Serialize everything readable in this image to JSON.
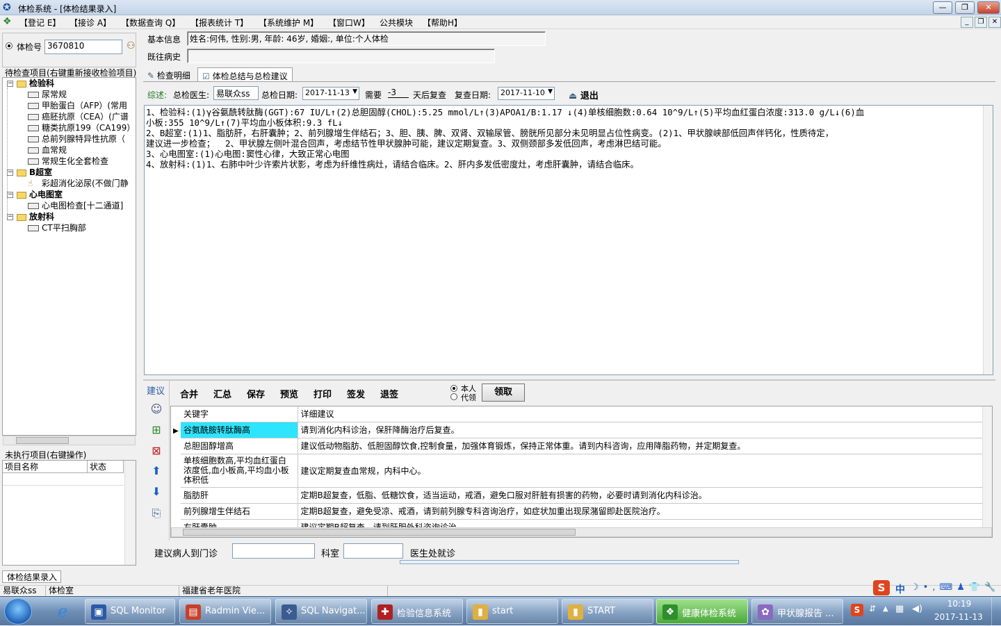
{
  "window": {
    "title": "体检系统 - [体检结果录入]"
  },
  "menu": [
    "【登记 E】",
    "【接诊 A】",
    "【数据查询 Q】",
    "【报表统计 T】",
    "【系统维护 M】",
    "【窗口W】",
    "公共模块",
    "【帮助H】"
  ],
  "left": {
    "exam_no_label": "体检号",
    "exam_no_value": "3670810",
    "pending_header": "待检查项目(右键重新接收检验项目)",
    "tree": [
      {
        "cat": "检验科",
        "items": [
          "尿常规",
          "甲胎蛋白（AFP）(常用",
          "癌胚抗原（CEA）(广谱",
          "糖类抗原199（CA199）",
          "总前列腺特异性抗原（",
          "血常规",
          "常规生化全套检查"
        ]
      },
      {
        "cat": "B超室",
        "items": [
          "彩超消化泌尿(不做门静"
        ]
      },
      {
        "cat": "心电图室",
        "items": [
          "心电图检查[十二通道]"
        ]
      },
      {
        "cat": "放射科",
        "items": [
          "CT平扫胸部"
        ]
      }
    ],
    "unexec_header": "未执行项目(右键操作)",
    "unexec_cols": [
      "项目名称",
      "状态"
    ],
    "tab_label": "体检结果录入"
  },
  "info": {
    "basic_label": "基本信息",
    "basic_value": "姓名:何伟, 性别:男, 年龄: 46岁, 婚姻:, 单位:个人体检",
    "history_label": "既往病史",
    "history_value": ""
  },
  "tabs": [
    "检查明细",
    "体检总结与总检建议"
  ],
  "summary_bar": {
    "label": "综述:",
    "doctor_label": "总检医生:",
    "doctor_value": "易联众ss",
    "date_label": "总检日期:",
    "date_value": "2017-11-13",
    "need_label": "需要",
    "need_value": "-3",
    "after_label": "天后复查",
    "review_label": "复查日期:",
    "review_value": "2017-11-10",
    "exit_label": "退出"
  },
  "summary_lines": [
    "1、检验科:(1)γ谷氨酰转肽酶(GGT):67 IU/L↑(2)总胆固醇(CHOL):5.25 mmol/L↑(3)APOA1/B:1.17 ↓(4)单核细胞数:0.64 10^9/L↑(5)平均血红蛋白浓度:313.0 g/L↓(6)血",
    "小板:355 10^9/L↑(7)平均血小板体积:9.3 fL↓",
    "2、B超室:(1)1、脂肪肝，右肝囊肿；2、前列腺增生伴结石；3、胆、胰、脾、双肾、双输尿管、膀胱所见部分未见明显占位性病变。(2)1、甲状腺峡部低回声伴钙化，性质待定，",
    "建议进一步检查；  2、甲状腺左侧叶混合回声，考虑结节性甲状腺肿可能，建议定期复查。3、双侧颈部多发低回声，考虑淋巴结可能。",
    "3、心电图室:(1)心电图:窦性心律，大致正常心电图",
    "4、放射科:(1)1、右肺中叶少许索片状影，考虑为纤维性病灶，请结合临床。2、肝内多发低密度灶，考虑肝囊肿，请结合临床。"
  ],
  "advice": {
    "side_label": "建议",
    "toolbar": [
      "合并",
      "汇总",
      "保存",
      "预览",
      "打印",
      "签发",
      "退签"
    ],
    "radio_self": "本人",
    "radio_proxy": "代领",
    "receive": "领取",
    "cols": [
      "关键字",
      "详细建议"
    ],
    "rows": [
      {
        "k": "谷氨酰胺转肽酶高",
        "v": "请到消化内科诊治，保肝降酶治疗后复查。"
      },
      {
        "k": "总胆固醇增高",
        "v": "建议低动物脂肪、低胆固醇饮食,控制食量，加强体育锻炼，保持正常体重。请到内科咨询，应用降脂药物，并定期复查。"
      },
      {
        "k": "单核细胞数高,平均血红蛋白浓度低,血小板高,平均血小板体积低",
        "v": "建议定期复查血常规，内科中心。"
      },
      {
        "k": "脂肪肝",
        "v": "定期B超复查，低脂、低糖饮食，适当运动，戒酒，避免口服对肝脏有损害的药物，必要时请到消化内科诊治。"
      },
      {
        "k": "前列腺增生伴结石",
        "v": "定期B超复查，避免受凉、戒酒，请到前列腺专科咨询治疗，如症状加重出现尿潴留即赴医院治疗。"
      },
      {
        "k": "右肝囊肿",
        "v": "建议定期B超复查，请到肝胆外科咨询诊治。"
      }
    ],
    "refer_label": "建议病人到门诊",
    "dept_label": "科室",
    "refer_tail": "医生处就诊"
  },
  "status": [
    "易联众ss",
    "体检室",
    "福建省老年医院"
  ],
  "taskbar": [
    {
      "label": "SQL Monitor",
      "color": "#2a5aa8"
    },
    {
      "label": "Radmin Vie...",
      "color": "#c8402a"
    },
    {
      "label": "SQL Navigat...",
      "color": "#3a5c90"
    },
    {
      "label": "检验信息系统",
      "color": "#b02020"
    },
    {
      "label": "start",
      "color": "#e0b040"
    },
    {
      "label": "START",
      "color": "#e0b040"
    },
    {
      "label": "健康体检系统",
      "color": "#2c8f2c"
    },
    {
      "label": "甲状腺报告 ...",
      "color": "#8a6ac0"
    }
  ],
  "tray": {
    "ime": "中",
    "time": "10:19",
    "date": "2017-11-13"
  }
}
